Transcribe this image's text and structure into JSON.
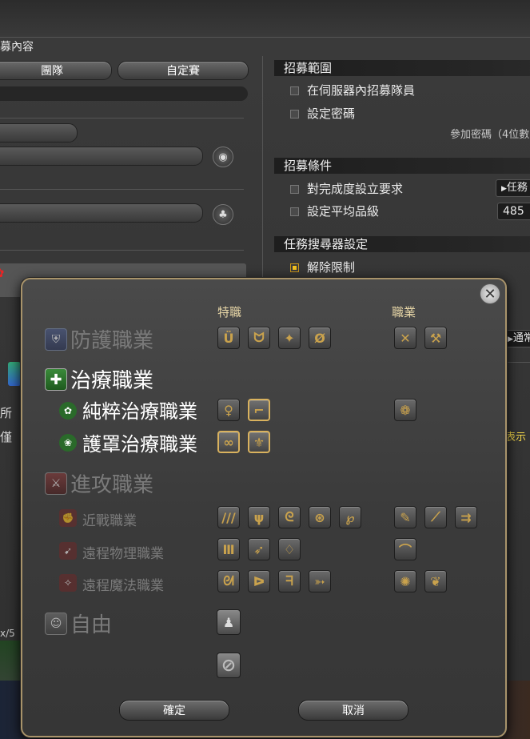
{
  "window": {
    "title": "募內容",
    "tabs": [
      "團隊",
      "自定賽"
    ],
    "left_partial_texts": [
      "所",
      "僅"
    ],
    "party_count": "x/5"
  },
  "right_panel": {
    "recruit_range": {
      "header": "招募範圍",
      "options": [
        {
          "label": "在伺服器內招募隊員",
          "checked": false
        },
        {
          "label": "設定密碼",
          "checked": false
        }
      ],
      "password_note": "參加密碼（4位數"
    },
    "recruit_conditions": {
      "header": "招募條件",
      "options": [
        {
          "label": "對完成度設立要求",
          "checked": false
        },
        {
          "label": "設定平均品級",
          "checked": false
        }
      ],
      "task_selector": "任務",
      "item_level": "485"
    },
    "duty_finder": {
      "header": "任務搜尋器設定",
      "options": [
        {
          "label": "解除限制",
          "checked": true
        }
      ]
    },
    "normal_label": "通常",
    "show_label": "表示",
    "arrow_icon": "▶"
  },
  "dialog": {
    "close_icon": "close-icon",
    "col_special": "特職",
    "col_class": "職業",
    "roles": {
      "tank": "防護職業",
      "healer": "治療職業",
      "pure_healer": "純粹治療職業",
      "barrier_healer": "護罩治療職業",
      "dps": "進攻職業",
      "melee": "近戰職業",
      "ranged_phys": "遠程物理職業",
      "ranged_magic": "遠程魔法職業",
      "free": "自由"
    },
    "jobs": {
      "tank": {
        "special": [
          "Ü",
          "ᗢ",
          "✦",
          "Ø"
        ],
        "class": [
          "✕",
          "⚒"
        ]
      },
      "pure_healer": {
        "special": [
          "♀",
          "⌐"
        ],
        "class": [
          "❁"
        ]
      },
      "barrier_healer": {
        "special": [
          "∞",
          "⚜"
        ],
        "class": []
      },
      "melee": {
        "special": [
          "///",
          "ψ",
          "ᘓ",
          "⊛",
          "℘"
        ],
        "class": [
          "✎",
          "⟋",
          "⇉"
        ]
      },
      "ranged_phys": {
        "special": [
          "Ⅲ",
          "➶",
          "♢"
        ],
        "class": [
          "⌒"
        ]
      },
      "ranged_magic": {
        "special": [
          "ᘛ",
          "ᐅ",
          "ᖷ",
          "➳"
        ],
        "class": [
          "✺",
          "❦"
        ]
      }
    },
    "selected": {
      "pure_healer": [
        1
      ],
      "barrier_healer": [
        0,
        1
      ]
    },
    "free_icon": "person-icon",
    "none_icon": "⊘",
    "confirm": "確定",
    "cancel": "取消"
  }
}
